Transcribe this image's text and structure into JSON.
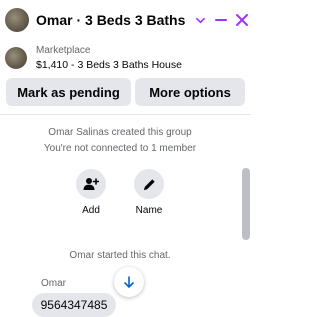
{
  "header": {
    "title": "Omar · 3 Beds 3 Baths Hou...",
    "chevron_icon": "chevron-down-icon",
    "minimize_icon": "minimize-icon",
    "close_icon": "close-icon",
    "accent_color": "#a033ff"
  },
  "listing": {
    "label": "Marketplace",
    "title": "$1,410 - 3 Beds 3 Baths House"
  },
  "actions": {
    "mark_pending": "Mark as pending",
    "more_options": "More options"
  },
  "chat": {
    "created_text": "Omar Salinas created this group",
    "not_connected_text": "You're not connected to 1 member",
    "add_label": "Add",
    "name_label": "Name",
    "started_text": "Omar started this chat.",
    "sender": "Omar",
    "message": "9564347485"
  }
}
